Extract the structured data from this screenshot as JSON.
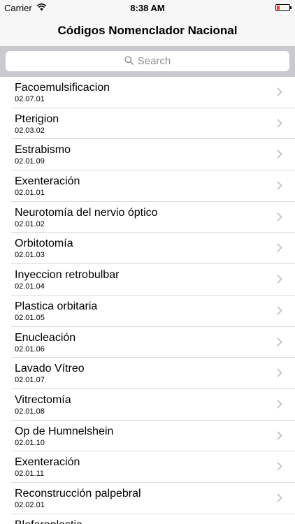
{
  "status": {
    "carrier": "Carrier",
    "time": "8:38 AM",
    "battery_level": 0.25,
    "battery_color": "#ff3b30"
  },
  "nav": {
    "title": "Códigos Nomenclador Nacional"
  },
  "search": {
    "placeholder": "Search"
  },
  "items": [
    {
      "title": "Facoemulsificacion",
      "code": "02.07.01"
    },
    {
      "title": "Pterigion",
      "code": "02.03.02"
    },
    {
      "title": "Estrabismo",
      "code": "02.01.09"
    },
    {
      "title": "Exenteración",
      "code": "02.01.01"
    },
    {
      "title": "Neurotomía del nervio óptico",
      "code": "02.01.02"
    },
    {
      "title": "Orbitotomía",
      "code": "02.01.03"
    },
    {
      "title": "Inyeccion retrobulbar",
      "code": "02.01.04"
    },
    {
      "title": "Plastica orbitaria",
      "code": "02.01.05"
    },
    {
      "title": "Enucleación",
      "code": "02.01.06"
    },
    {
      "title": "Lavado Vítreo",
      "code": "02.01.07"
    },
    {
      "title": "Vitrectomía",
      "code": "02.01.08"
    },
    {
      "title": "Op de Humnelshein",
      "code": "02.01.10"
    },
    {
      "title": "Exenteración",
      "code": "02.01.11"
    },
    {
      "title": "Reconstrucción palpebral",
      "code": "02.02.01"
    },
    {
      "title": "Blefaroplastia",
      "code": ""
    }
  ]
}
